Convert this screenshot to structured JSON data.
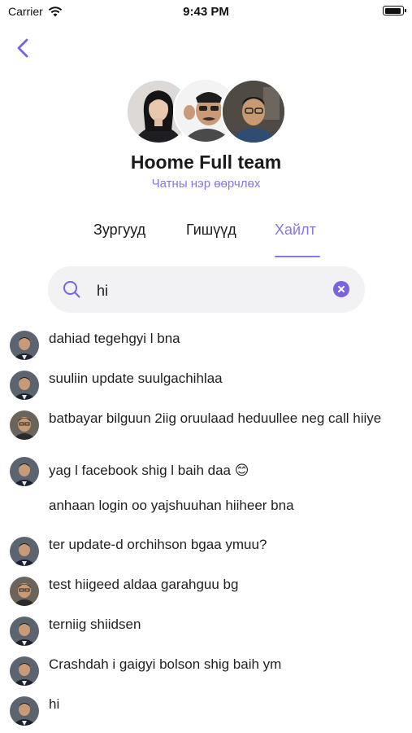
{
  "status_bar": {
    "carrier": "Carrier",
    "time": "9:43 PM"
  },
  "header": {
    "title": "Hoome Full team",
    "rename_label": "Чатны нэр өөрчлөх"
  },
  "tabs": [
    {
      "label": "Зургууд",
      "active": false
    },
    {
      "label": "Гишүүд",
      "active": false
    },
    {
      "label": "Хайлт",
      "active": true
    }
  ],
  "search": {
    "value": "hi"
  },
  "results": [
    {
      "text": "dahiad tegehgyi l bna",
      "avatar": "avatar-suit"
    },
    {
      "text": "suuliin update suulgachihlaa",
      "avatar": "avatar-suit"
    },
    {
      "text": "batbayar bilguun 2iig oruulaad heduullee neg call hiiye",
      "avatar": "avatar-glasses"
    },
    {
      "text": "yag l facebook shig l baih daa 😊",
      "avatar": "avatar-suit"
    },
    {
      "text": "anhaan login oo yajshuuhan hiiheer bna",
      "avatar": ""
    },
    {
      "text": "ter update-d orchihson bgaa ymuu?",
      "avatar": "avatar-suit"
    },
    {
      "text": "test hiigeed aldaa garahguu bg",
      "avatar": "avatar-glasses"
    },
    {
      "text": "terniig shiidsen",
      "avatar": "avatar-suit"
    },
    {
      "text": "Crashdah i gaigyi bolson shig baih ym",
      "avatar": "avatar-suit"
    },
    {
      "text": "hi",
      "avatar": "avatar-suit"
    }
  ],
  "colors": {
    "accent": "#8a74e6",
    "search_bg": "#f2f2f4",
    "clear_button": "#7a63e0"
  }
}
